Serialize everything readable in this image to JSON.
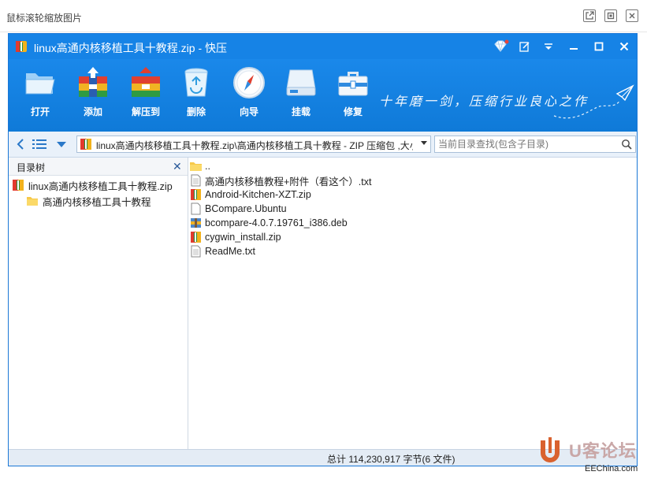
{
  "viewer": {
    "title": "鼠标滚轮缩放图片",
    "buttons": [
      "open-external-icon",
      "fullscreen-icon",
      "close-icon"
    ]
  },
  "window": {
    "title": "linux高通内核移植工具十教程.zip - 快压",
    "controls": [
      "diamond-icon",
      "edit-icon",
      "dropdown-icon",
      "minimize-icon",
      "maximize-icon",
      "close-icon"
    ]
  },
  "toolbar": {
    "items": [
      {
        "label": "打开",
        "icon": "folder-open-icon"
      },
      {
        "label": "添加",
        "icon": "add-archive-icon"
      },
      {
        "label": "解压到",
        "icon": "extract-icon"
      },
      {
        "label": "删除",
        "icon": "recycle-bin-icon"
      },
      {
        "label": "向导",
        "icon": "compass-icon"
      },
      {
        "label": "挂载",
        "icon": "drive-icon"
      },
      {
        "label": "修复",
        "icon": "toolbox-icon"
      }
    ],
    "slogan": "十年磨一剑，压缩行业良心之作"
  },
  "nav": {
    "path": "linux高通内核移植工具十教程.zip\\高通内核移植工具十教程 - ZIP 压缩包 ,大小",
    "search_placeholder": "当前目录查找(包含子目录)"
  },
  "tree": {
    "header": "目录树",
    "items": [
      {
        "label": "linux高通内核移植工具十教程.zip",
        "icon": "zip-archive-icon",
        "level": 0
      },
      {
        "label": "高通内核移植工具十教程",
        "icon": "folder-icon",
        "level": 1
      }
    ]
  },
  "files": [
    {
      "name": "..",
      "icon": "folder-up-icon"
    },
    {
      "name": "高通内核移植教程+附件（看这个）.txt",
      "icon": "text-file-icon"
    },
    {
      "name": "Android-Kitchen-XZT.zip",
      "icon": "zip-archive-icon"
    },
    {
      "name": "BCompare.Ubuntu",
      "icon": "blank-file-icon"
    },
    {
      "name": "bcompare-4.0.7.19761_i386.deb",
      "icon": "deb-package-icon"
    },
    {
      "name": "cygwin_install.zip",
      "icon": "zip-archive-icon"
    },
    {
      "name": "ReadMe.txt",
      "icon": "text-file-icon"
    }
  ],
  "status": {
    "summary": "总计  114,230,917 字节(6 文件)"
  },
  "watermark": {
    "text": "U客论坛",
    "site": "EEChina.com"
  },
  "colors": {
    "titlebar": "#1683e6",
    "toolbar": "#1a88ea",
    "navbar": "#e9f1fa",
    "status": "#e4ecf5"
  }
}
